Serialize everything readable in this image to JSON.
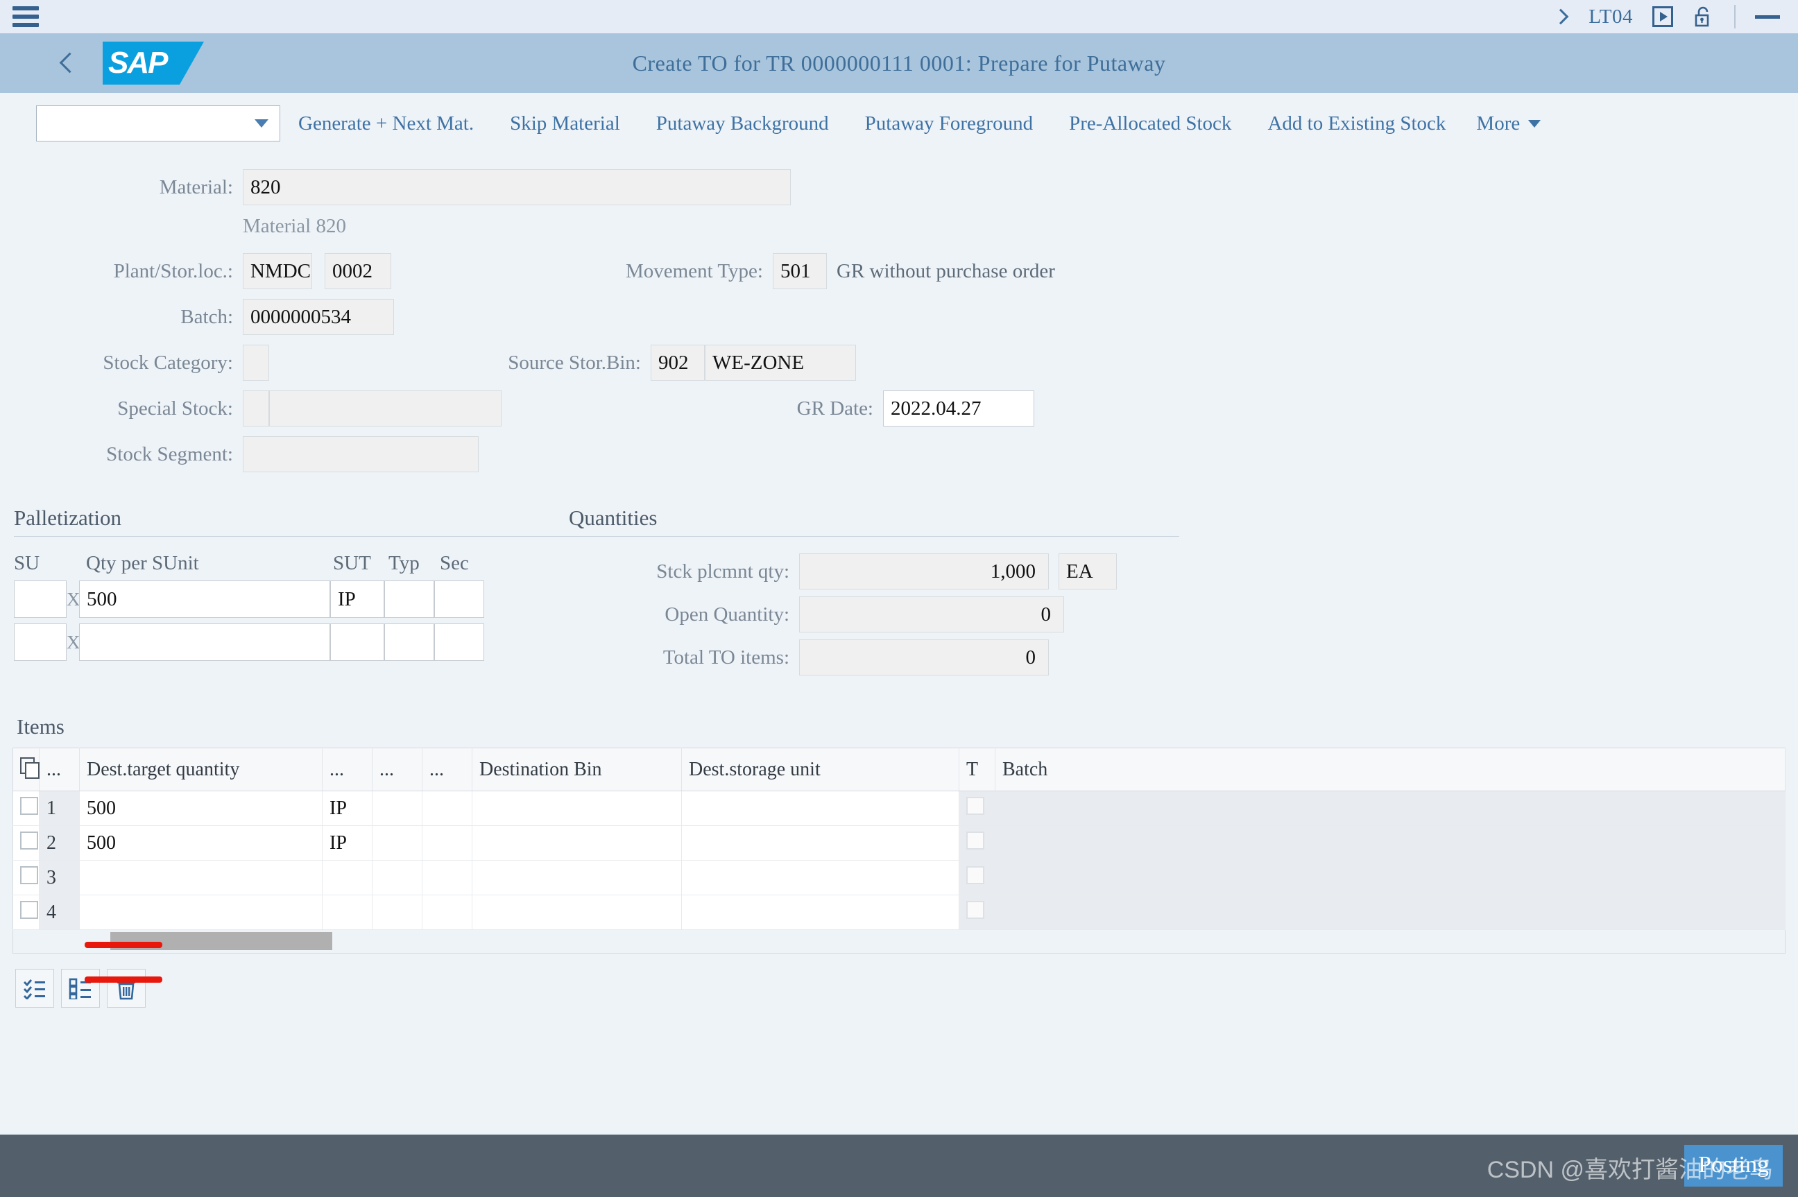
{
  "shellbar": {
    "menu_icon": "hamburger-icon",
    "expand_icon": "chevron-right-icon",
    "user": "LT04",
    "play_icon": "play-box-icon",
    "lock_icon": "unlocked-padlock-icon",
    "minimize_icon": "minimize-icon"
  },
  "header": {
    "back_icon": "back-chevron-icon",
    "logo": "SAP",
    "title": "Create TO for TR 0000000111 0001: Prepare for Putaway"
  },
  "toolbar": {
    "select_value": "",
    "select_icon": "chevron-down-icon",
    "buttons": [
      "Generate + Next Mat.",
      "Skip Material",
      "Putaway Background",
      "Putaway Foreground",
      "Pre-Allocated Stock",
      "Add to Existing Stock"
    ],
    "more_label": "More",
    "more_icon": "chevron-down-icon"
  },
  "form": {
    "material_label": "Material:",
    "material_value": "820",
    "material_desc": "Material 820",
    "plant_label": "Plant/Stor.loc.:",
    "plant_value": "NMDC",
    "storloc_value": "0002",
    "batch_label": "Batch:",
    "batch_value": "0000000534",
    "stock_category_label": "Stock Category:",
    "stock_category_value": "",
    "special_stock_label": "Special Stock:",
    "special_stock_value": "",
    "special_stock_desc": "",
    "stock_segment_label": "Stock Segment:",
    "stock_segment_value": "",
    "movement_type_label": "Movement Type:",
    "movement_type_value": "501",
    "movement_type_desc": "GR without purchase order",
    "source_bin_label": "Source Stor.Bin:",
    "source_bin_value": "902",
    "source_bin_desc": "WE-ZONE",
    "gr_date_label": "GR Date:",
    "gr_date_value": "2022.04.27"
  },
  "palletization": {
    "title": "Palletization",
    "headers": {
      "su": "SU",
      "qty": "Qty per SUnit",
      "sut": "SUT",
      "typ": "Typ",
      "sec": "Sec"
    },
    "multiply": "X",
    "rows": [
      {
        "su": "",
        "qty": "500",
        "sut": "IP",
        "typ": "",
        "sec": ""
      },
      {
        "su": "",
        "qty": "",
        "sut": "",
        "typ": "",
        "sec": ""
      }
    ]
  },
  "quantities": {
    "title": "Quantities",
    "stck_plcmnt_label": "Stck plcmnt qty:",
    "stck_plcmnt_value": "1,000",
    "stck_plcmnt_uom": "EA",
    "open_quantity_label": "Open Quantity:",
    "open_quantity_value": "0",
    "total_to_label": "Total TO items:",
    "total_to_value": "0"
  },
  "items": {
    "title": "Items",
    "select_icon": "copy-select-icon",
    "columns": [
      "...",
      "Dest.target quantity",
      "...",
      "...",
      "...",
      "Destination Bin",
      "Dest.storage unit",
      "T",
      "Batch"
    ],
    "rows": [
      {
        "num": "1",
        "qty": "500",
        "uom": "IP",
        "c3": "",
        "c4": "",
        "bin": "",
        "unit": "",
        "t": false,
        "batch": ""
      },
      {
        "num": "2",
        "qty": "500",
        "uom": "IP",
        "c3": "",
        "c4": "",
        "bin": "",
        "unit": "",
        "t": false,
        "batch": ""
      },
      {
        "num": "3",
        "qty": "",
        "uom": "",
        "c3": "",
        "c4": "",
        "bin": "",
        "unit": "",
        "t": false,
        "batch": ""
      },
      {
        "num": "4",
        "qty": "",
        "uom": "",
        "c3": "",
        "c4": "",
        "bin": "",
        "unit": "",
        "t": false,
        "batch": ""
      }
    ],
    "scrollbar": "horizontal-scrollbar"
  },
  "bottom_icons": [
    {
      "name": "select-all-icon"
    },
    {
      "name": "deselect-all-icon"
    },
    {
      "name": "delete-icon"
    }
  ],
  "footer": {
    "posting_label": "Posting",
    "watermark": "CSDN @喜欢打酱油的老鸟"
  },
  "annotations": {
    "accent_color": "#e8180c",
    "marks": 2
  }
}
